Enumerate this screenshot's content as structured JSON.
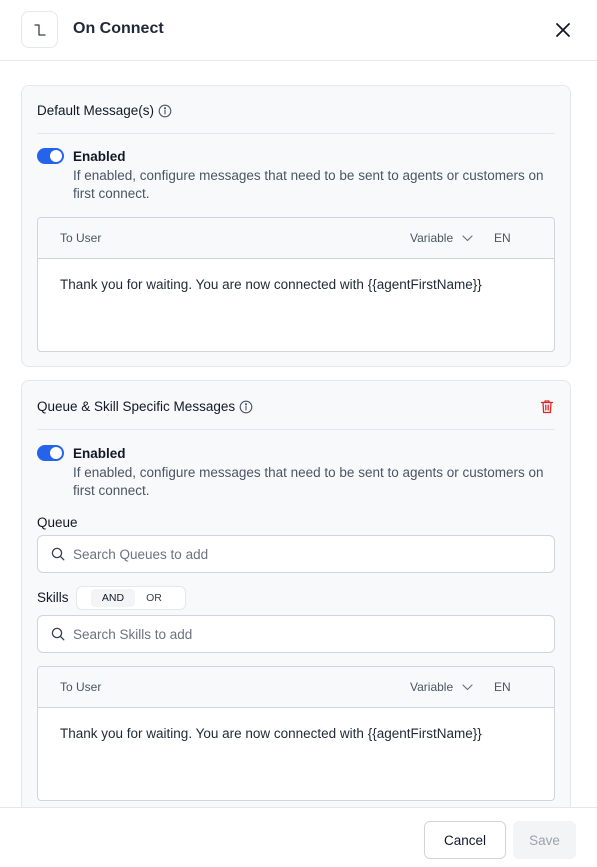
{
  "header": {
    "title": "On Connect",
    "icon": "step-connector-icon",
    "close_icon": "close-icon"
  },
  "default_messages": {
    "title": "Default Message(s)",
    "toggle": {
      "label": "Enabled",
      "enabled": true,
      "description": "If enabled, configure messages that need to be sent to agents or customers on first connect."
    },
    "message": {
      "to_label": "To User",
      "variable_label": "Variable",
      "language": "EN",
      "text": "Thank you for waiting. You are now connected with {{agentFirstName}}"
    }
  },
  "queue_skill_messages": {
    "title": "Queue & Skill Specific Messages",
    "toggle": {
      "label": "Enabled",
      "enabled": true,
      "description": "If enabled, configure messages that need to be sent to agents or customers on first connect."
    },
    "queue": {
      "label": "Queue",
      "placeholder": "Search Queues to add",
      "value": ""
    },
    "skills": {
      "label": "Skills",
      "options": [
        "AND",
        "OR"
      ],
      "selected": "AND",
      "placeholder": "Search Skills to add",
      "value": ""
    },
    "message": {
      "to_label": "To User",
      "variable_label": "Variable",
      "language": "EN",
      "text": "Thank you for waiting. You are now connected with {{agentFirstName}}"
    }
  },
  "footer": {
    "cancel_label": "Cancel",
    "save_label": "Save"
  },
  "colors": {
    "accent": "#2563eb",
    "danger": "#dc2626"
  }
}
